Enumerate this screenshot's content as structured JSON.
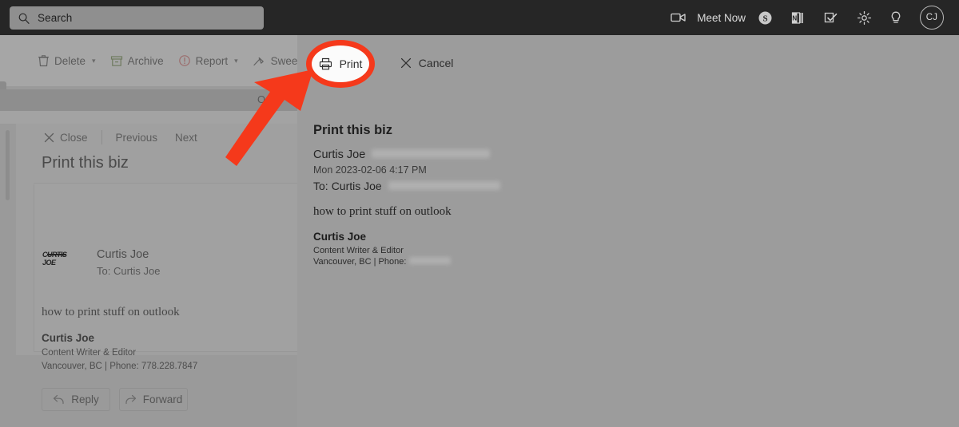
{
  "topbar": {
    "search": {
      "placeholder": "Search",
      "value": "",
      "icon": "search-icon"
    },
    "meet_now_label": "Meet Now",
    "icons": [
      {
        "name": "video-camera-icon",
        "glyph": "camera"
      },
      {
        "name": "skype-icon",
        "glyph": "skype"
      },
      {
        "name": "office-icon",
        "glyph": "office"
      },
      {
        "name": "to-do-icon",
        "glyph": "todo"
      },
      {
        "name": "settings-gear-icon",
        "glyph": "gear"
      },
      {
        "name": "help-lightbulb-icon",
        "glyph": "bulb"
      }
    ],
    "avatar_initials": "CJ",
    "background_color": "#262626"
  },
  "command_bar": {
    "buttons": [
      {
        "label": "Delete",
        "icon": "trash-icon",
        "has_caret": true
      },
      {
        "label": "Archive",
        "icon": "archive-box-icon",
        "has_caret": false
      },
      {
        "label": "Report",
        "icon": "report-shield-icon",
        "has_caret": true
      },
      {
        "label": "Sweep",
        "icon": "broom-icon",
        "has_caret": false
      },
      {
        "label": "",
        "icon": "move-to-icon",
        "has_caret": false
      }
    ]
  },
  "folder_strip": {
    "label": "Ou"
  },
  "reading_pane": {
    "toolbar": {
      "close_label": "Close",
      "previous_label": "Previous",
      "next_label": "Next"
    },
    "subject": "Print this biz",
    "sender_logo_text": "CURTIS JOE",
    "sender_name": "Curtis Joe",
    "recipient_line": "To:  Curtis Joe",
    "body": "how to print stuff on outlook",
    "signature": {
      "name": "Curtis Joe",
      "title": "Content Writer & Editor",
      "location": "Vancouver, BC | Phone: 778.228.7847"
    },
    "reply_label": "Reply",
    "forward_label": "Forward"
  },
  "print_preview": {
    "print_label": "Print",
    "cancel_label": "Cancel",
    "subject": "Print this biz",
    "from_name": "Curtis Joe",
    "from_email_redacted": true,
    "date": "Mon 2023-02-06 4:17 PM",
    "to_prefix": "To:",
    "to_name": "Curtis Joe",
    "to_email_redacted": true,
    "body": "how to print stuff on outlook",
    "signature": {
      "name": "Curtis Joe",
      "title": "Content Writer & Editor",
      "location_prefix": "Vancouver, BC | Phone:",
      "phone_redacted": true
    },
    "background_color": "#9c9c9c"
  },
  "annotations": {
    "highlight_color": "#F5391B",
    "highlight_target": "Print",
    "arrow_color": "#F5391B"
  }
}
